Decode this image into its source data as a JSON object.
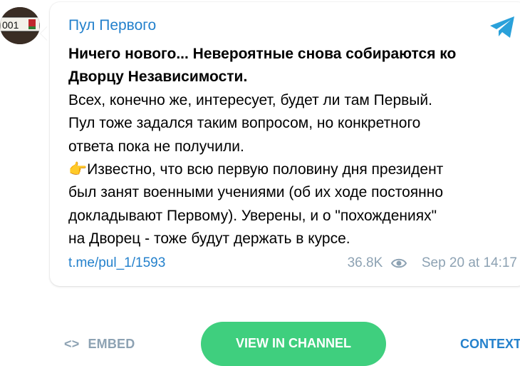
{
  "post": {
    "channel_name": "Пул Первого",
    "avatar_plate_text": "001",
    "bold_line_1": "Ничего нового... Невероятные снова собираются ко",
    "bold_line_2": "Дворцу Независимости.",
    "line_1": "Всех, конечно же, интересует, будет ли там Первый.",
    "line_2": "Пул тоже задался таким вопросом, но конкретного",
    "line_3": "ответа пока не получили.",
    "emoji": "👉",
    "line_4": "Известно, что всю первую половину дня президент",
    "line_5": "был занят военными учениями (об их ходе постоянно",
    "line_6": "докладывают Первому). Уверены, и о \"похождениях\"",
    "line_7": "на Дворец - тоже будут держать в курсе.",
    "link": "t.me/pul_1/1593",
    "views": "36.8K",
    "date": "Sep 20 at 14:17"
  },
  "actions": {
    "embed_icon": "<>",
    "embed_label": "EMBED",
    "view_label": "VIEW IN CHANNEL",
    "context_label": "CONTEXT"
  },
  "colors": {
    "link": "#2481cc",
    "meta": "#8da2b3",
    "button": "#3fcf7e"
  },
  "icons": [
    "telegram-icon",
    "eye-icon",
    "code-icon",
    "pointing-hand-emoji"
  ]
}
